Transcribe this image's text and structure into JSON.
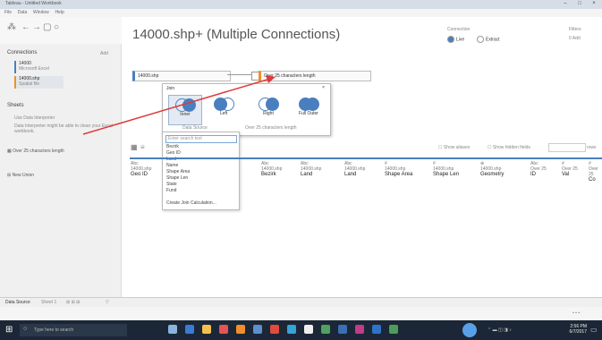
{
  "window": {
    "title": "Tableau - Untitled Workbook"
  },
  "menu": [
    "File",
    "Data",
    "Window",
    "Help"
  ],
  "connections": {
    "header": "Connections",
    "add": "Add",
    "items": [
      {
        "name": "14000",
        "sub": "Microsoft Excel"
      },
      {
        "name": "14000.shp",
        "sub": "Spatial file"
      }
    ]
  },
  "sheets": {
    "header": "Sheets",
    "items": [
      "Use Data Interpreter",
      "Data Interpreter might be able to clean your Excel workbook.",
      "Over 25 characters length"
    ],
    "new_union": "New Union"
  },
  "datasource": {
    "title": "14000.shp+ (Multiple Connections)",
    "connection_label": "Connection",
    "live": "Live",
    "extract": "Extract",
    "filters_label": "Filters",
    "filters_value": "0 Add",
    "table_left": "14000.shp",
    "table_right": "Over 25 characters length"
  },
  "join_popup": {
    "title": "Join",
    "options": [
      {
        "label": "Inner"
      },
      {
        "label": "Left"
      },
      {
        "label": "Right"
      },
      {
        "label": "Full Outer"
      }
    ],
    "left_source": "Data Source",
    "right_source": "Over 25 characters length"
  },
  "field_dropdown": {
    "search_placeholder": "Enter search text",
    "items": [
      "Bezirk",
      "Geo ID",
      "Land",
      "Name",
      "Shape Area",
      "Shape Len",
      "State",
      "Fund"
    ],
    "footer": "Create Join Calculation..."
  },
  "grid_toolbar": {
    "show_aliases": "Show aliases",
    "show_hidden": "Show hidden fields",
    "rows": "rows"
  },
  "columns": [
    {
      "type": "Abc",
      "src": "14000.shp",
      "name": "Geo ID"
    },
    {
      "type": "Abc",
      "src": "14000.shp",
      "name": "Land"
    },
    {
      "type": "Abc",
      "src": "14000.shp",
      "name": "Bezirk"
    },
    {
      "type": "Abc",
      "src": "14000.shp",
      "name": "Land"
    },
    {
      "type": "#",
      "src": "14000.shp",
      "name": "Shape Area"
    },
    {
      "type": "#",
      "src": "14000.shp",
      "name": "Shape Len"
    },
    {
      "type": "⊕",
      "src": "14000.shp",
      "name": "Geometry"
    },
    {
      "type": "Abc",
      "src": "Over 25",
      "name": "ID"
    },
    {
      "type": "#",
      "src": "Over 25",
      "name": "Val"
    },
    {
      "type": "#",
      "src": "Over 25",
      "name": "Co"
    }
  ],
  "bottom_tabs": {
    "data_source": "Data Source",
    "sheet": "Sheet 1"
  },
  "taskbar": {
    "search": "Type here to search",
    "time": "2:56 PM",
    "date": "6/7/2017"
  },
  "colors": {
    "accent": "#4a7fbf",
    "arrow": "#e03a3a",
    "taskbar": "#1b2736"
  }
}
